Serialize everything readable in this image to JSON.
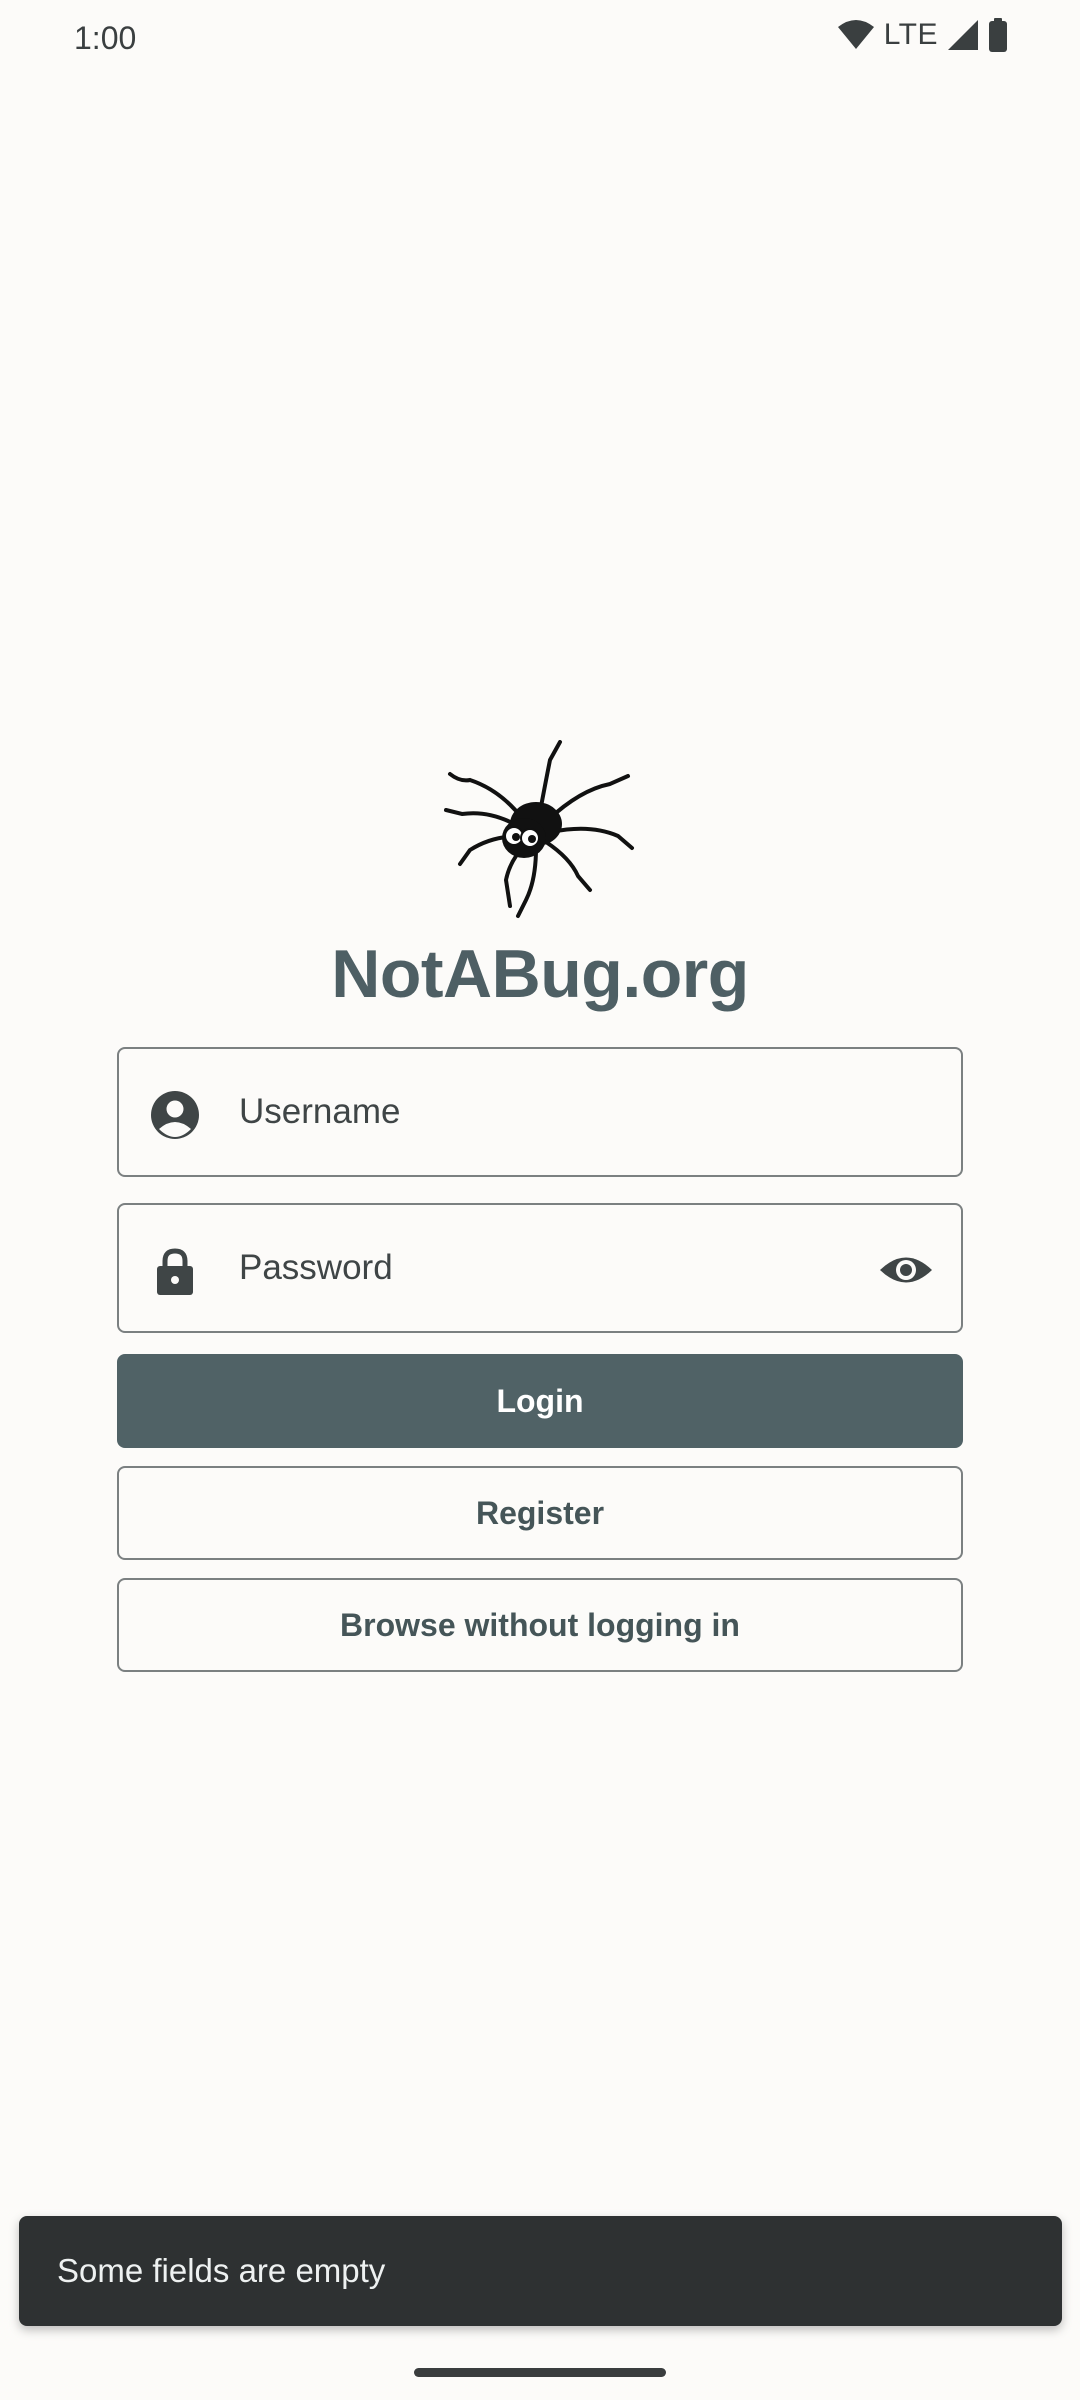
{
  "status_bar": {
    "time": "1:00",
    "network": "LTE",
    "icons": [
      "wifi-icon",
      "cell-signal-icon",
      "battery-icon"
    ]
  },
  "app": {
    "title": "NotABug.org",
    "logo_icon": "spider-logo-icon",
    "brand_color": "#4e5f64"
  },
  "login_form": {
    "username": {
      "placeholder": "Username",
      "value": "",
      "icon": "account-circle-icon"
    },
    "password": {
      "placeholder": "Password",
      "value": "",
      "icon": "lock-icon",
      "toggle_icon": "eye-icon"
    },
    "login_label": "Login",
    "register_label": "Register",
    "browse_label": "Browse without logging in"
  },
  "snackbar": {
    "message": "Some fields are empty"
  },
  "colors": {
    "background": "#fcfbf9",
    "primary_button": "#506266",
    "outline": "#7b8081",
    "snackbar": "#2e3132"
  }
}
